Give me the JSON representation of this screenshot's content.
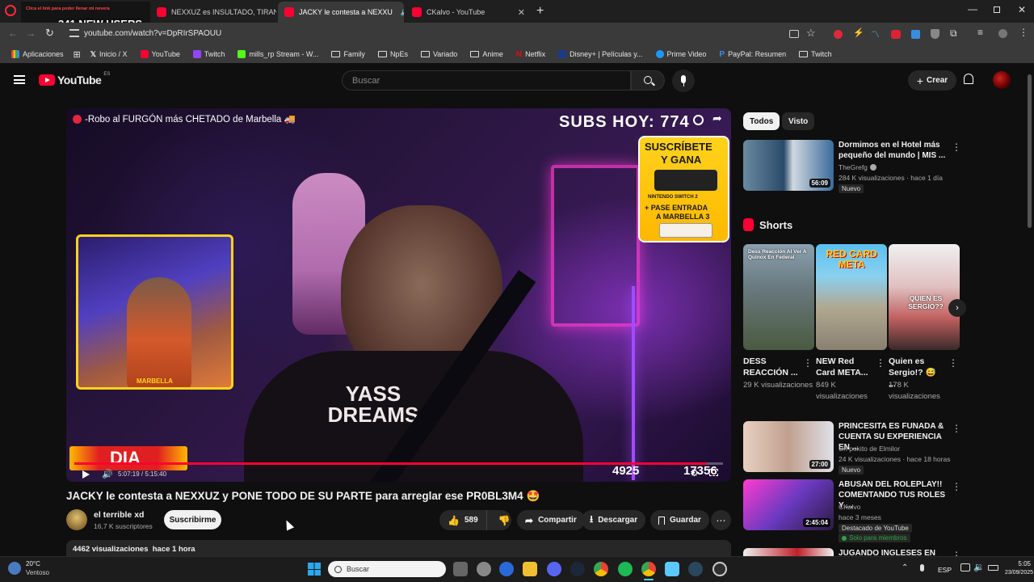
{
  "browser": {
    "tabs": [
      {
        "label": "",
        "overlay_small": "Clica el link para poder llenar mi nevera",
        "overlay_big": "341 NEW USERS"
      },
      {
        "label": "NEXXUZ es INSULTADO, TIRAN"
      },
      {
        "label": "JACKY le contesta a NEXXU"
      },
      {
        "label": "CKalvo - YouTube"
      }
    ],
    "url": "youtube.com/watch?v=DpRIrSPAOUU",
    "bookmarks": [
      "Aplicaciones",
      "Inicio / X",
      "YouTube",
      "Twitch",
      "mills_rp Stream - W...",
      "Family",
      "NpEs",
      "Variado",
      "Anime",
      "Netflix",
      "Disney+ | Películas y...",
      "Prime Video",
      "PayPal: Resumen",
      "Twitch"
    ]
  },
  "youtube": {
    "logo": "YouTube",
    "logo_region": "ES",
    "search_placeholder": "Buscar",
    "create_label": "Crear"
  },
  "video": {
    "overlay_title": "-Robo al FURGÓN más CHETADO de Marbella 🚚",
    "subs_today": "SUBS HOY: 774",
    "promo_line1": "SUSCRÍBETE",
    "promo_line2": "Y GANA",
    "promo_line3": "NINTENDO SWITCH 2",
    "promo_line4": "+ PASE ENTRADA",
    "promo_line5": "A MARBELLA 3",
    "shirt_text": "YASS DREAMS",
    "cam_logo": "MARBELLA",
    "day_label": "DIA",
    "stat_1": "4925",
    "stat_2": "17356",
    "time_display": "5:07:19 / 5:15:40",
    "progress": 0.975
  },
  "watch": {
    "title": "JACKY le contesta a NEXXUZ y PONE TODO DE SU PARTE para arreglar ese PR0BL3M4 🤩",
    "channel": "el terrible xd",
    "subscribers": "16,7 K suscriptores",
    "subscribe_label": "Suscribirme",
    "likes": "589",
    "share_label": "Compartir",
    "download_label": "Descargar",
    "save_label": "Guardar",
    "views_line": "4462 visualizaciones  hace 1 hora"
  },
  "sidebar": {
    "chips": [
      "Todos",
      "Visto"
    ],
    "shorts_label": "Shorts",
    "videos": [
      {
        "title": "Dormimos en el Hotel más pequeño del mundo | MIS ...",
        "channel": "TheGrefg",
        "meta": "284 K visualizaciones · hace 1 día",
        "badge": "Nuevo",
        "duration": "56:09"
      },
      {
        "title": "PRINCESITA ES FUNADA & CUENTA SU EXPERIENCIA EN ...",
        "channel": "Un pokito de Elmilor",
        "meta": "24 K visualizaciones · hace 18 horas",
        "badge": "Nuevo",
        "duration": "27:00"
      },
      {
        "title": "ABUSAN DEL ROLEPLAY!! COMENTANDO TUS ROLES Y ...",
        "channel": "CKalvo",
        "meta": "hace 3 meses",
        "badge": "Destacado de YouTube",
        "badge2": "Solo para miembros",
        "duration": "2:45:04"
      },
      {
        "title": "JUGANDO INGLESES EN"
      }
    ],
    "shorts": [
      {
        "title": "DESS REACCIÓN ...",
        "views": "29 K visualizaciones",
        "overlay": "Dess Reacción Al Ver A Quinox En Federal"
      },
      {
        "title": "NEW Red Card META...",
        "views": "849 K visualizaciones",
        "overlay": "RED CARD META"
      },
      {
        "title": "Quien es Sergio!? 😅 ...",
        "views": "178 K visualizaciones",
        "overlay": "QUIEN ES SERGIO??"
      }
    ]
  },
  "taskbar": {
    "temp": "20°C",
    "weather": "Ventoso",
    "search": "Buscar",
    "lang": "ESP",
    "time": "5:05",
    "date": "23/09/2025"
  }
}
